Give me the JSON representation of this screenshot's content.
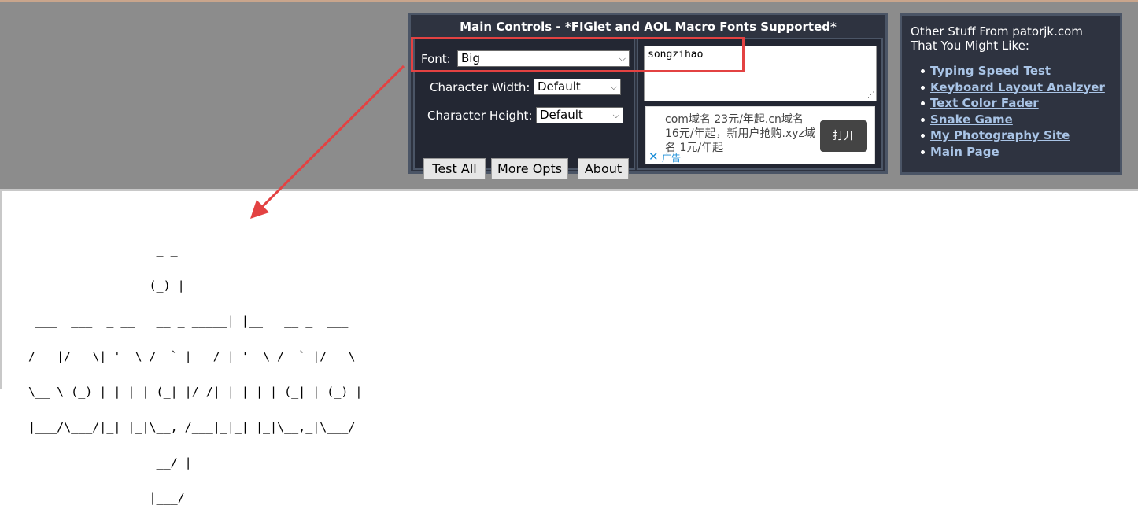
{
  "main_panel": {
    "title": "Main Controls - *FIGlet and AOL Macro Fonts Supported*",
    "font_label": "Font:",
    "font_value": "Big",
    "char_width_label": "Character Width:",
    "char_width_value": "Default",
    "char_height_label": "Character Height:",
    "char_height_value": "Default",
    "buttons": {
      "test_all": "Test All",
      "more_opts": "More Opts",
      "about": "About"
    },
    "input_text": "songzihao"
  },
  "ad": {
    "text": "com域名 23元/年起.cn域名 16元/年起，新用户抢购.xyz域名 1元/年起",
    "open_label": "打开",
    "close_symbol": "✕",
    "ad_label": "广告"
  },
  "other_panel": {
    "heading_line1": "Other Stuff From patorjk.com",
    "heading_line2": "That You Might Like:",
    "links": [
      "Typing Speed Test",
      "Keyboard Layout Analzyer",
      "Text Color Fader",
      "Snake Game",
      "My Photography Site",
      "Main Page"
    ]
  },
  "output": {
    "ascii_lines": [
      "                  _ _",
      "                 (_) |",
      " ___  ___  _ __   __ _ _____| |__   __ _  ___",
      "/ __|/ _ \\| '_ \\ / _` |_  / | '_ \\ / _` |/ _ \\",
      "\\__ \\ (_) | | | | (_| |/ /| | | | | (_| | (_) |",
      "|___/\\___/|_| |_|\\__, /___|_|_| |_|\\__,_|\\___/",
      "                  __/ |",
      "                 |___/"
    ]
  },
  "colors": {
    "top_band": "#8c8c8c",
    "panel_bg": "#2e3340",
    "panel_border": "#4b5566",
    "link": "#a9c4e6",
    "annotation_red": "#e34242"
  }
}
